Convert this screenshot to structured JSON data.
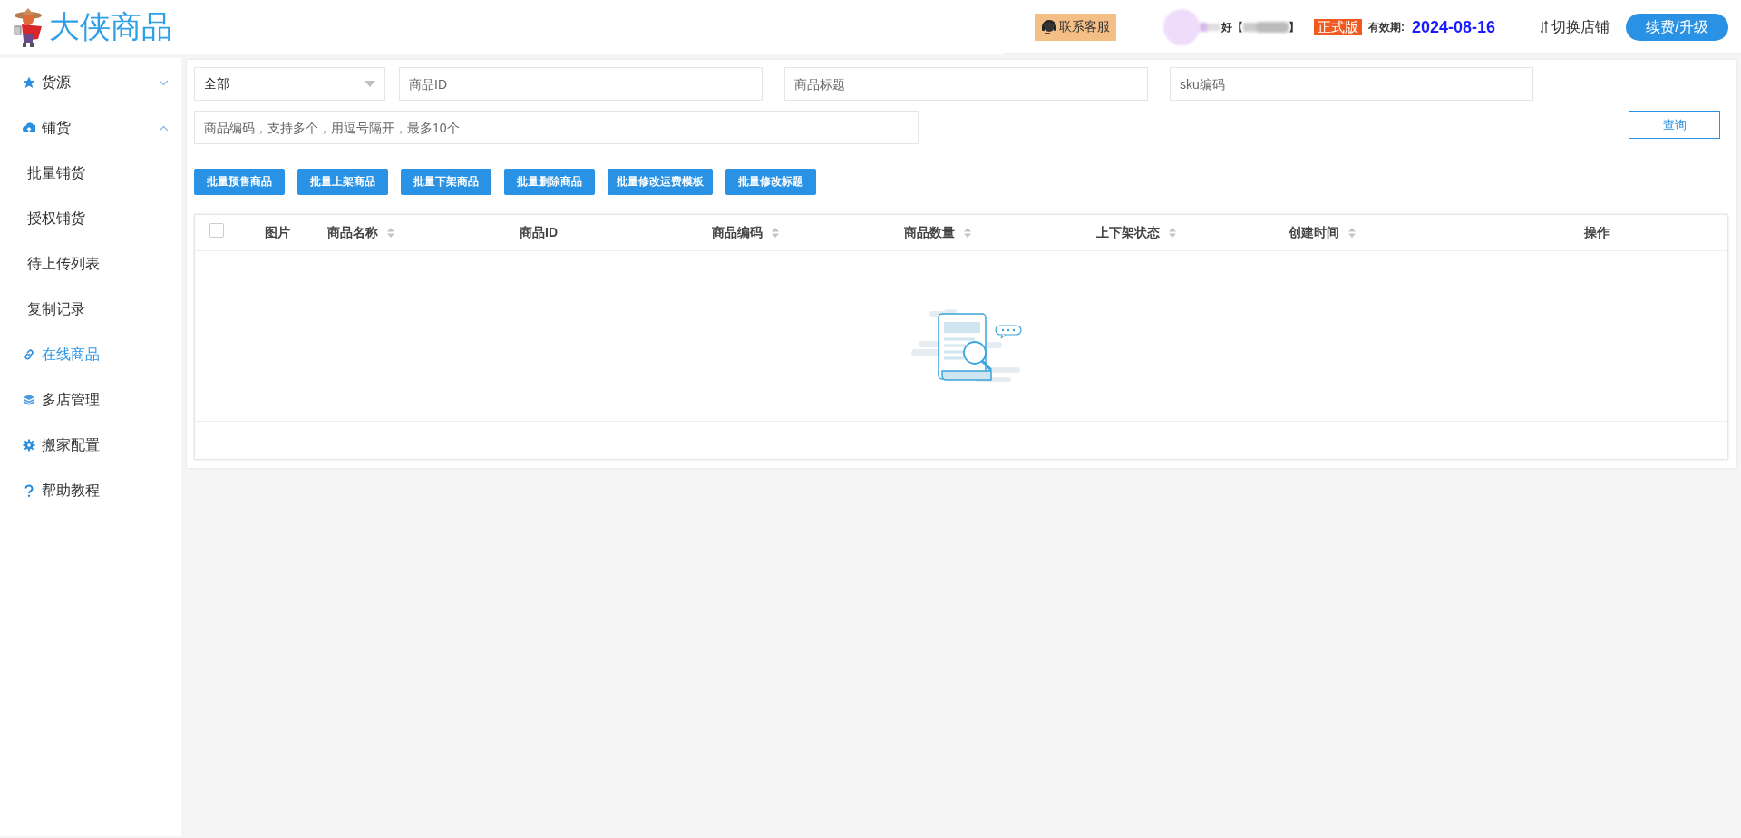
{
  "header": {
    "logo_text": "大侠商品",
    "support_button": "联系客服",
    "greeting_prefix": "好【",
    "greeting_suffix": "】",
    "edition_badge": "正式版",
    "expiry_label": "有效期:",
    "expiry_date": "2024-08-16",
    "switch_shop": "切换店铺",
    "upgrade_button": "续费/升级"
  },
  "sidebar": {
    "items": [
      {
        "label": "货源",
        "selected": false,
        "expanded": false
      },
      {
        "label": "铺货",
        "selected": false,
        "expanded": true,
        "children": [
          {
            "label": "批量铺货",
            "selected": false
          },
          {
            "label": "授权铺货",
            "selected": false
          },
          {
            "label": "待上传列表",
            "selected": false
          },
          {
            "label": "复制记录",
            "selected": false
          }
        ]
      },
      {
        "label": "在线商品",
        "selected": true
      },
      {
        "label": "多店管理",
        "selected": false
      },
      {
        "label": "搬家配置",
        "selected": false
      },
      {
        "label": "帮助教程",
        "selected": false
      }
    ]
  },
  "filters": {
    "status_select": "全部",
    "product_id": {
      "placeholder": "商品ID"
    },
    "product_title": {
      "placeholder": "商品标题"
    },
    "sku_code": {
      "placeholder": "sku编码"
    },
    "product_codes": {
      "placeholder": "商品编码，支持多个，用逗号隔开，最多10个"
    },
    "query_button": "查询"
  },
  "batch_buttons": [
    "批量预售商品",
    "批量上架商品",
    "批量下架商品",
    "批量删除商品",
    "批量修改运费模板",
    "批量修改标题"
  ],
  "table": {
    "select_all_checked": false,
    "columns": [
      {
        "label": "图片",
        "sortable": false
      },
      {
        "label": "商品名称",
        "sortable": true
      },
      {
        "label": "商品ID",
        "sortable": false
      },
      {
        "label": "商品编码",
        "sortable": true
      },
      {
        "label": "商品数量",
        "sortable": true
      },
      {
        "label": "上下架状态",
        "sortable": true
      },
      {
        "label": "创建时间",
        "sortable": true
      },
      {
        "label": "操作",
        "sortable": false
      }
    ]
  }
}
